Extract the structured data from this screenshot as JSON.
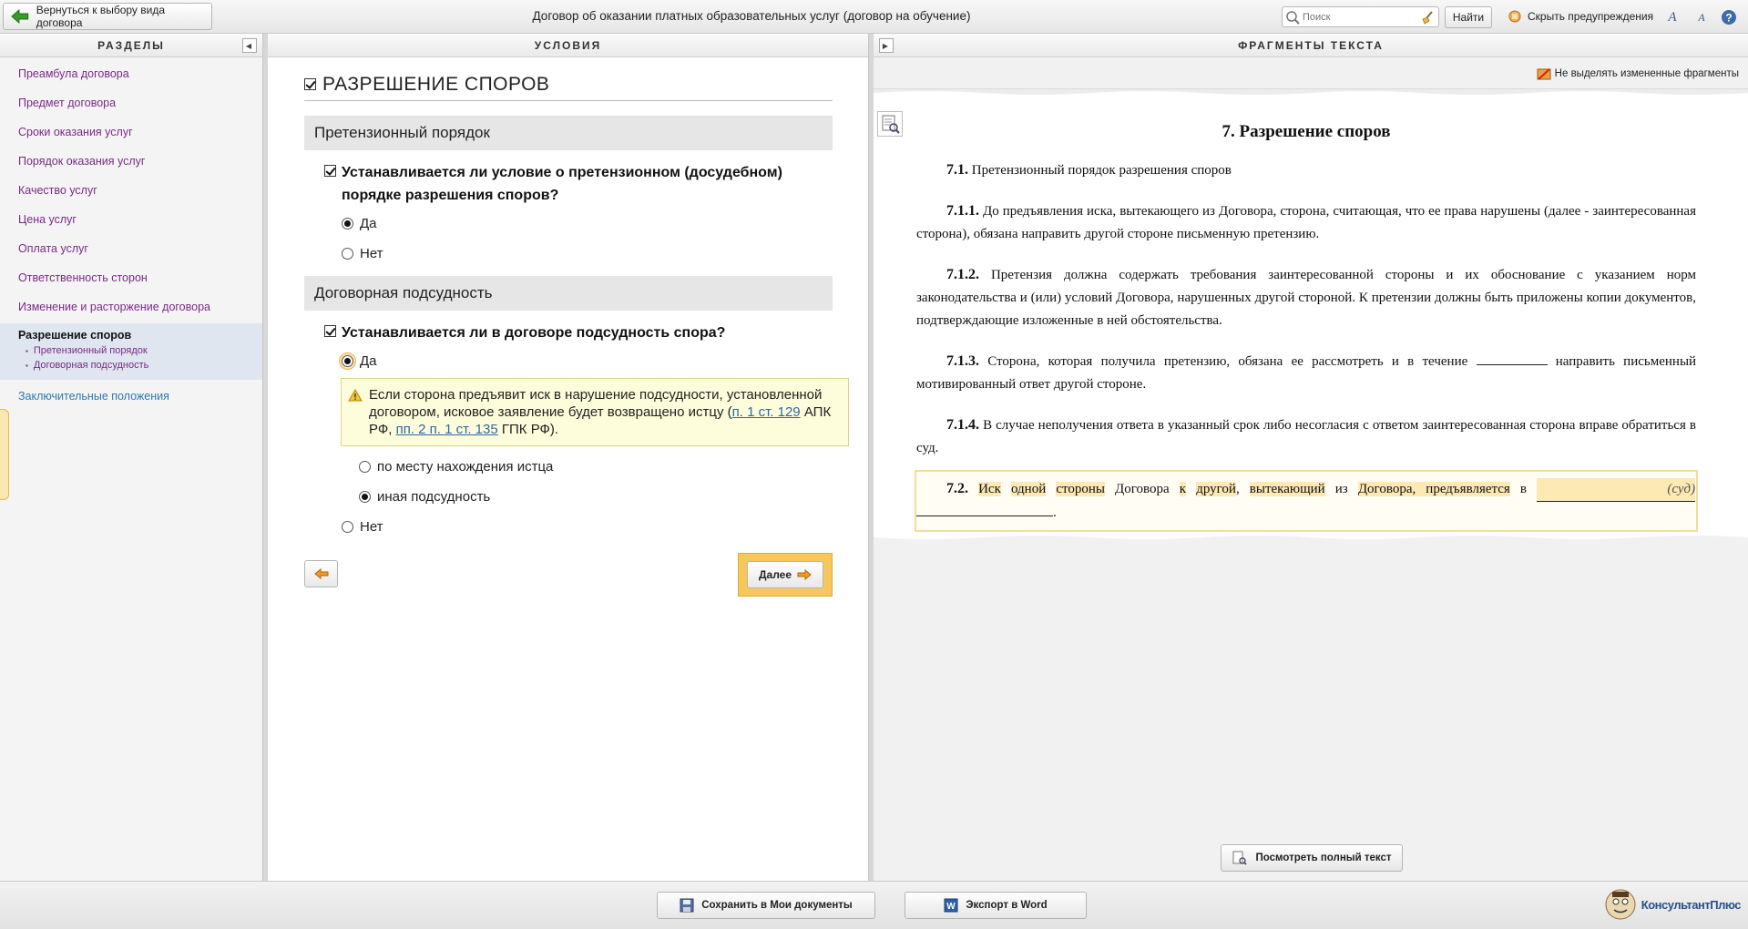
{
  "toolbar": {
    "back_label": "Вернуться к выбору вида договора",
    "title": "Договор об оказании платных образовательных услуг (договор на обучение)",
    "search_placeholder": "Поиск",
    "find_label": "Найти",
    "hide_warnings_label": "Скрыть предупреждения",
    "font_increase": "A",
    "font_decrease": "A"
  },
  "left_panel": {
    "header": "РАЗДЕЛЫ",
    "items": [
      {
        "label": "Преамбула договора"
      },
      {
        "label": "Предмет договора"
      },
      {
        "label": "Сроки оказания услуг"
      },
      {
        "label": "Порядок оказания услуг"
      },
      {
        "label": "Качество услуг"
      },
      {
        "label": "Цена услуг"
      },
      {
        "label": "Оплата услуг"
      },
      {
        "label": "Ответственность сторон"
      },
      {
        "label": "Изменение и расторжение договора"
      }
    ],
    "active": {
      "label": "Разрешение споров",
      "subitems": [
        {
          "label": "Претензионный порядок"
        },
        {
          "label": "Договорная подсудность"
        }
      ]
    },
    "last_item": "Заключительные положения"
  },
  "middle_panel": {
    "header": "УСЛОВИЯ",
    "section_title": "РАЗРЕШЕНИЕ СПОРОВ",
    "block1": {
      "title": "Претензионный порядок",
      "question": "Устанавливается ли условие о претензионном (досудебном) порядке разрешения споров?",
      "yes": "Да",
      "no": "Нет",
      "selected": "yes"
    },
    "block2": {
      "title": "Договорная подсудность",
      "question": "Устанавливается ли в договоре подсудность спора?",
      "yes": "Да",
      "warning_text_1": "Если сторона предъявит иск в нарушение подсудности, установленной договором, исковое заявление будет возвращено истцу (",
      "warning_link_1": "п. 1 ст. 129",
      "warning_text_2": " АПК РФ, ",
      "warning_link_2": "пп. 2 п. 1 ст. 135",
      "warning_text_3": " ГПК РФ).",
      "option_1": "по месту нахождения истца",
      "option_2": "иная подсудность",
      "selected_option": "option_2",
      "no": "Нет"
    },
    "next_label": "Далее"
  },
  "right_panel": {
    "header": "ФРАГМЕНТЫ ТЕКСТА",
    "no_highlight_label": "Не выделять измененные фрагменты",
    "doc_title_num": "7.",
    "doc_title": "Разрешение споров",
    "p71_num": "7.1.",
    "p71": "Претензионный порядок разрешения споров",
    "p711_num": "7.1.1.",
    "p711": "До предъявления иска, вытекающего из Договора, сторона, считающая, что ее права нарушены (далее - заинтересованная сторона), обязана направить другой стороне письменную претензию.",
    "p712_num": "7.1.2.",
    "p712": "Претензия должна содержать требования заинтересованной стороны и их обоснование с указанием норм законодательства и (или) условий Договора, нарушенных другой стороной. К претензии должны быть приложены копии документов, подтверждающие изложенные в ней обстоятельства.",
    "p713_num": "7.1.3.",
    "p713_a": "Сторона, которая получила претензию, обязана ее рассмотреть и в течение",
    "p713_b": "направить письменный мотивированный ответ другой стороне.",
    "p714_num": "7.1.4.",
    "p714": "В случае неполучения ответа в указанный срок либо несогласия с ответом заинтересованная сторона вправе обратиться в суд.",
    "p72_num": "7.2.",
    "p72_w1": "Иск",
    "p72_w2": "одной",
    "p72_w3": "стороны",
    "p72_w4": "Договора",
    "p72_w5": "к",
    "p72_w6": "другой",
    "p72_w7": "вытекающий",
    "p72_w8": "из",
    "p72_w9": "Договора, предъявляется",
    "p72_w10": "в",
    "p72_sud": "(суд)",
    "full_text_label": "Посмотреть полный текст"
  },
  "bottom_bar": {
    "save_label": "Сохранить в Мои документы",
    "export_label": "Экспорт в Word",
    "logo_text": "КонсультантПлюс"
  }
}
